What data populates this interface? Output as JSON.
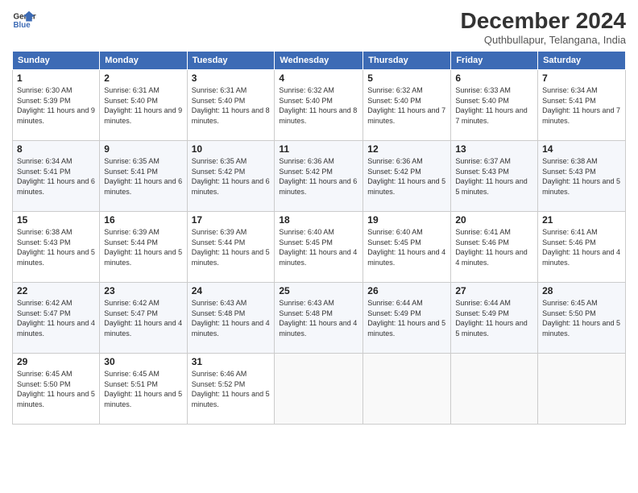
{
  "header": {
    "month": "December 2024",
    "location": "Quthbullapur, Telangana, India",
    "logo_line1": "General",
    "logo_line2": "Blue"
  },
  "columns": [
    "Sunday",
    "Monday",
    "Tuesday",
    "Wednesday",
    "Thursday",
    "Friday",
    "Saturday"
  ],
  "weeks": [
    [
      {
        "day": "1",
        "sunrise": "6:30 AM",
        "sunset": "5:39 PM",
        "daylight": "11 hours and 9 minutes."
      },
      {
        "day": "2",
        "sunrise": "6:31 AM",
        "sunset": "5:40 PM",
        "daylight": "11 hours and 9 minutes."
      },
      {
        "day": "3",
        "sunrise": "6:31 AM",
        "sunset": "5:40 PM",
        "daylight": "11 hours and 8 minutes."
      },
      {
        "day": "4",
        "sunrise": "6:32 AM",
        "sunset": "5:40 PM",
        "daylight": "11 hours and 8 minutes."
      },
      {
        "day": "5",
        "sunrise": "6:32 AM",
        "sunset": "5:40 PM",
        "daylight": "11 hours and 7 minutes."
      },
      {
        "day": "6",
        "sunrise": "6:33 AM",
        "sunset": "5:40 PM",
        "daylight": "11 hours and 7 minutes."
      },
      {
        "day": "7",
        "sunrise": "6:34 AM",
        "sunset": "5:41 PM",
        "daylight": "11 hours and 7 minutes."
      }
    ],
    [
      {
        "day": "8",
        "sunrise": "6:34 AM",
        "sunset": "5:41 PM",
        "daylight": "11 hours and 6 minutes."
      },
      {
        "day": "9",
        "sunrise": "6:35 AM",
        "sunset": "5:41 PM",
        "daylight": "11 hours and 6 minutes."
      },
      {
        "day": "10",
        "sunrise": "6:35 AM",
        "sunset": "5:42 PM",
        "daylight": "11 hours and 6 minutes."
      },
      {
        "day": "11",
        "sunrise": "6:36 AM",
        "sunset": "5:42 PM",
        "daylight": "11 hours and 6 minutes."
      },
      {
        "day": "12",
        "sunrise": "6:36 AM",
        "sunset": "5:42 PM",
        "daylight": "11 hours and 5 minutes."
      },
      {
        "day": "13",
        "sunrise": "6:37 AM",
        "sunset": "5:43 PM",
        "daylight": "11 hours and 5 minutes."
      },
      {
        "day": "14",
        "sunrise": "6:38 AM",
        "sunset": "5:43 PM",
        "daylight": "11 hours and 5 minutes."
      }
    ],
    [
      {
        "day": "15",
        "sunrise": "6:38 AM",
        "sunset": "5:43 PM",
        "daylight": "11 hours and 5 minutes."
      },
      {
        "day": "16",
        "sunrise": "6:39 AM",
        "sunset": "5:44 PM",
        "daylight": "11 hours and 5 minutes."
      },
      {
        "day": "17",
        "sunrise": "6:39 AM",
        "sunset": "5:44 PM",
        "daylight": "11 hours and 5 minutes."
      },
      {
        "day": "18",
        "sunrise": "6:40 AM",
        "sunset": "5:45 PM",
        "daylight": "11 hours and 4 minutes."
      },
      {
        "day": "19",
        "sunrise": "6:40 AM",
        "sunset": "5:45 PM",
        "daylight": "11 hours and 4 minutes."
      },
      {
        "day": "20",
        "sunrise": "6:41 AM",
        "sunset": "5:46 PM",
        "daylight": "11 hours and 4 minutes."
      },
      {
        "day": "21",
        "sunrise": "6:41 AM",
        "sunset": "5:46 PM",
        "daylight": "11 hours and 4 minutes."
      }
    ],
    [
      {
        "day": "22",
        "sunrise": "6:42 AM",
        "sunset": "5:47 PM",
        "daylight": "11 hours and 4 minutes."
      },
      {
        "day": "23",
        "sunrise": "6:42 AM",
        "sunset": "5:47 PM",
        "daylight": "11 hours and 4 minutes."
      },
      {
        "day": "24",
        "sunrise": "6:43 AM",
        "sunset": "5:48 PM",
        "daylight": "11 hours and 4 minutes."
      },
      {
        "day": "25",
        "sunrise": "6:43 AM",
        "sunset": "5:48 PM",
        "daylight": "11 hours and 4 minutes."
      },
      {
        "day": "26",
        "sunrise": "6:44 AM",
        "sunset": "5:49 PM",
        "daylight": "11 hours and 5 minutes."
      },
      {
        "day": "27",
        "sunrise": "6:44 AM",
        "sunset": "5:49 PM",
        "daylight": "11 hours and 5 minutes."
      },
      {
        "day": "28",
        "sunrise": "6:45 AM",
        "sunset": "5:50 PM",
        "daylight": "11 hours and 5 minutes."
      }
    ],
    [
      {
        "day": "29",
        "sunrise": "6:45 AM",
        "sunset": "5:50 PM",
        "daylight": "11 hours and 5 minutes."
      },
      {
        "day": "30",
        "sunrise": "6:45 AM",
        "sunset": "5:51 PM",
        "daylight": "11 hours and 5 minutes."
      },
      {
        "day": "31",
        "sunrise": "6:46 AM",
        "sunset": "5:52 PM",
        "daylight": "11 hours and 5 minutes."
      },
      null,
      null,
      null,
      null
    ]
  ]
}
